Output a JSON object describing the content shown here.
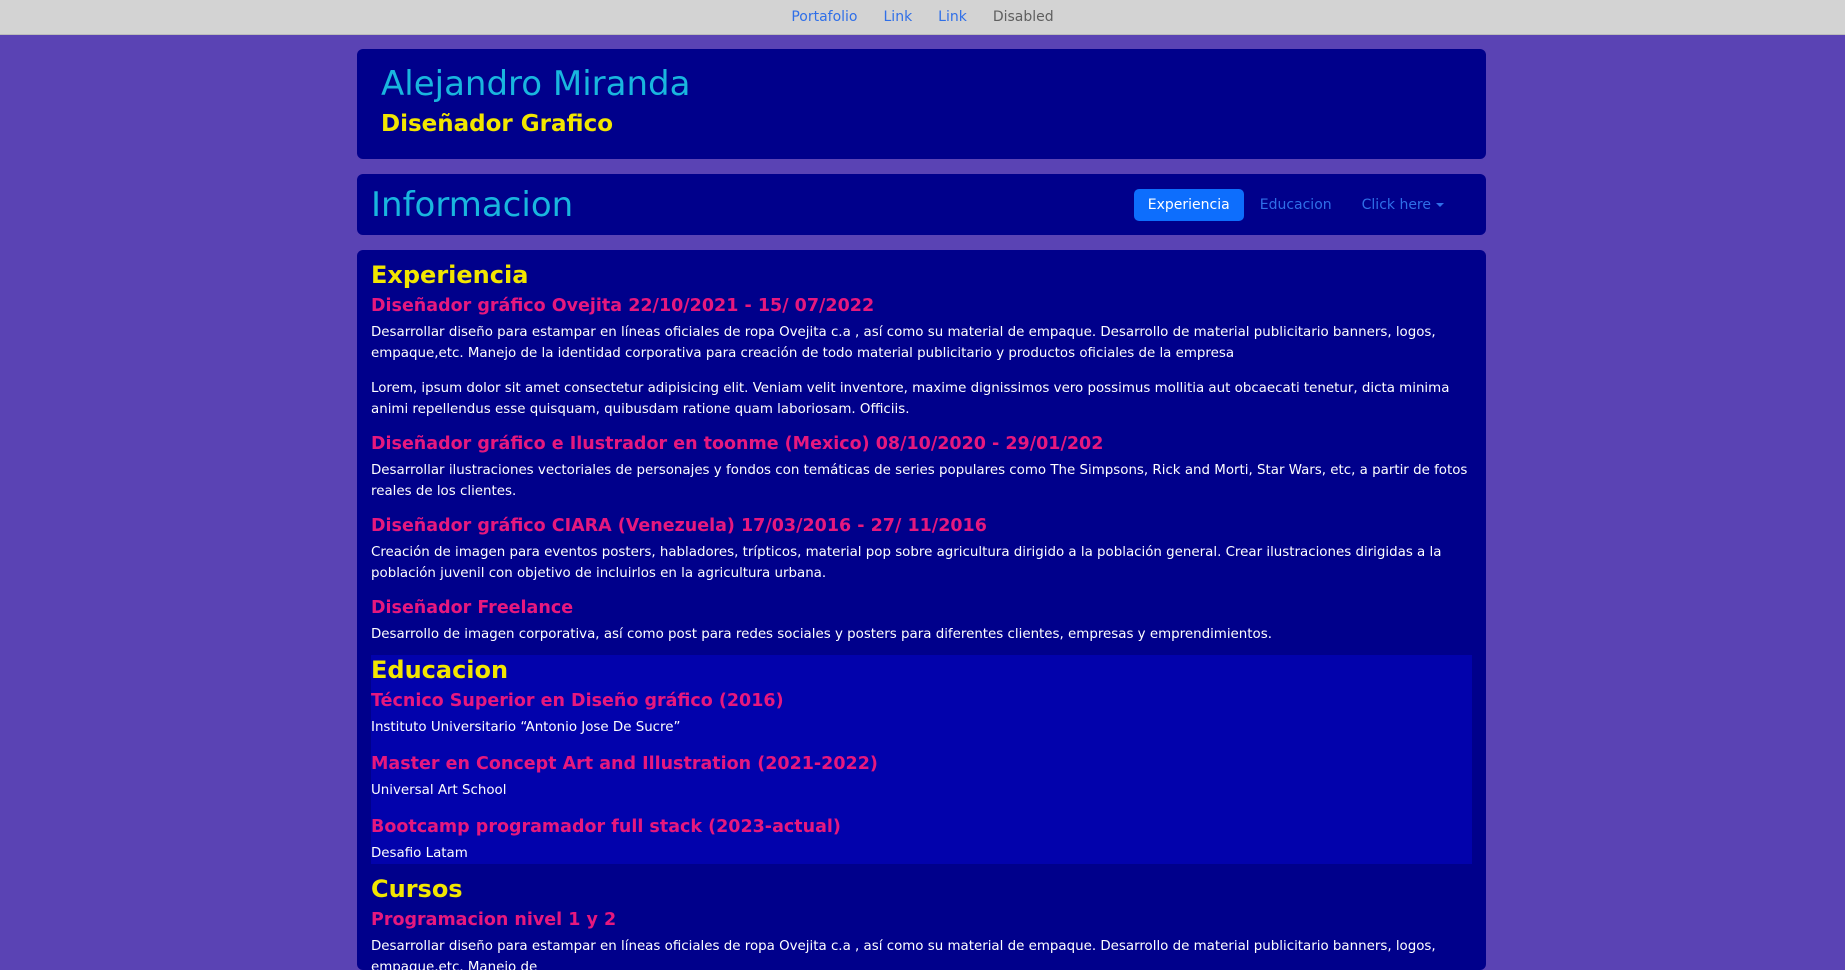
{
  "topnav": {
    "items": [
      "Portafolio",
      "Link",
      "Link"
    ],
    "disabled": "Disabled"
  },
  "header": {
    "name": "Alejandro Miranda",
    "role": "Diseñador Grafico"
  },
  "infobar": {
    "title": "Informacion",
    "tabs": [
      "Experiencia",
      "Educacion",
      "Click here"
    ],
    "active_tab": "Experiencia"
  },
  "experience": {
    "title": "Experiencia",
    "items": [
      {
        "title": "Diseñador gráfico Ovejita 22/10/2021 - 15/ 07/2022",
        "paragraphs": [
          "Desarrollar diseño para estampar en líneas oficiales de ropa Ovejita c.a , así como su material de empaque. Desarrollo de material publicitario banners, logos, empaque,etc. Manejo de la identidad corporativa para creación de todo material publicitario y productos oficiales de la empresa",
          "Lorem, ipsum dolor sit amet consectetur adipisicing elit. Veniam velit inventore, maxime dignissimos vero possimus mollitia aut obcaecati tenetur, dicta minima animi repellendus esse quisquam, quibusdam ratione quam laboriosam. Officiis."
        ]
      },
      {
        "title": "Diseñador gráfico e Ilustrador en toonme (Mexico) 08/10/2020 - 29/01/202",
        "paragraphs": [
          "Desarrollar ilustraciones vectoriales de personajes y fondos con temáticas de series populares como The Simpsons, Rick and Morti, Star Wars, etc, a partir de fotos reales de los clientes."
        ]
      },
      {
        "title": "Diseñador gráfico CIARA (Venezuela) 17/03/2016 - 27/ 11/2016",
        "paragraphs": [
          "Creación de imagen para eventos posters, habladores, trípticos, material pop sobre agricultura dirigido a la población general. Crear ilustraciones dirigidas a la población juvenil con objetivo de incluirlos en la agricultura urbana."
        ]
      },
      {
        "title": "Diseñador Freelance",
        "paragraphs": [
          "Desarrollo de imagen corporativa, así como post para redes sociales y posters para diferentes clientes, empresas y emprendimientos."
        ]
      }
    ]
  },
  "education": {
    "title": "Educacion",
    "items": [
      {
        "title": "Técnico Superior en Diseño gráfico (2016)",
        "place": "Instituto Universitario “Antonio Jose De Sucre”"
      },
      {
        "title": "Master en Concept Art and Illustration (2021-2022)",
        "place": "Universal Art School"
      },
      {
        "title": "Bootcamp programador full stack (2023-actual)",
        "place": "Desafio Latam"
      }
    ]
  },
  "courses": {
    "title": "Cursos",
    "items": [
      {
        "title": "Programacion nivel 1 y 2",
        "text": "Desarrollar diseño para estampar en líneas oficiales de ropa Ovejita c.a , así como su material de empaque. Desarrollo de material publicitario banners, logos, empaque,etc. Manejo de"
      }
    ]
  },
  "colors": {
    "page_bg": "#5a43b4",
    "card_bg": "#00008b",
    "accent_cyan": "#19b6de",
    "accent_yellow": "#f2e600",
    "accent_pink": "#e6187e",
    "primary_button": "#0d6efd"
  }
}
